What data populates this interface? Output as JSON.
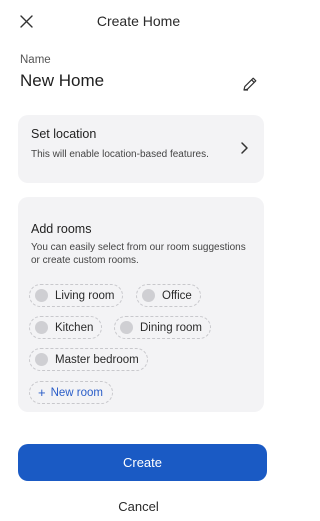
{
  "header": {
    "title": "Create Home",
    "close_icon": "close-icon"
  },
  "name": {
    "label": "Name",
    "value": "New Home",
    "edit_icon": "pencil-icon"
  },
  "location": {
    "title": "Set location",
    "description": "This will enable location-based features.",
    "chevron_icon": "chevron-right-icon"
  },
  "rooms": {
    "title": "Add rooms",
    "description": "You can easily select from our room suggestions or create custom rooms.",
    "suggestions": [
      "Living room",
      "Office",
      "Kitchen",
      "Dining room",
      "Master bedroom"
    ],
    "new_room_label": "New room"
  },
  "actions": {
    "create_label": "Create",
    "cancel_label": "Cancel"
  },
  "colors": {
    "accent": "#1a5ac4",
    "card_background": "#f3f3f5",
    "link": "#2a5dc8"
  }
}
